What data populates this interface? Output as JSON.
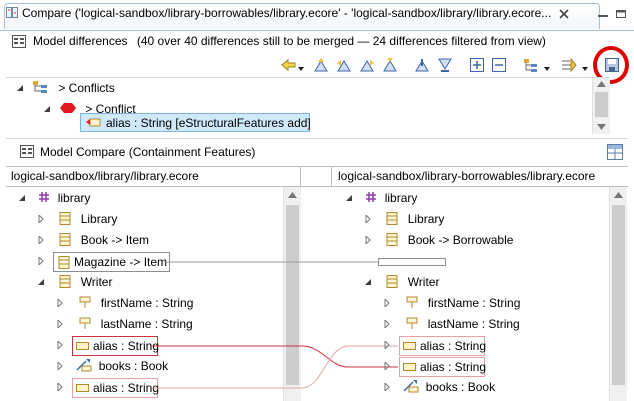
{
  "window": {
    "title": "Compare ('logical-sandbox/library-borrowables/library.ecore' - 'logical-sandbox/library/library.ecore..."
  },
  "differences": {
    "header": "Model differences",
    "summary": "(40 over 40 differences still to be merged — 24 differences filtered from view)",
    "tree": [
      {
        "label": "> Conflicts"
      },
      {
        "label": "> Conflict"
      },
      {
        "label": "alias : String [eStructuralFeatures add]"
      }
    ]
  },
  "compare": {
    "header": "Model Compare (Containment Features)",
    "left_path": "logical-sandbox/library/library.ecore",
    "right_path": "logical-sandbox/library-borrowables/library.ecore",
    "left_tree": [
      {
        "label": "library"
      },
      {
        "label": "Library"
      },
      {
        "label": "Book -> Item"
      },
      {
        "label": "Magazine -> Item"
      },
      {
        "label": "Writer"
      },
      {
        "label": "firstName : String"
      },
      {
        "label": "lastName : String"
      },
      {
        "label": "alias : String"
      },
      {
        "label": "books : Book"
      },
      {
        "label": "alias : String"
      }
    ],
    "right_tree": [
      {
        "label": "library"
      },
      {
        "label": "Library"
      },
      {
        "label": "Book -> Borrowable"
      },
      {
        "label": "Writer"
      },
      {
        "label": "firstName : String"
      },
      {
        "label": "lastName : String"
      },
      {
        "label": "alias : String"
      },
      {
        "label": "alias : String"
      },
      {
        "label": "books : Book"
      }
    ]
  }
}
